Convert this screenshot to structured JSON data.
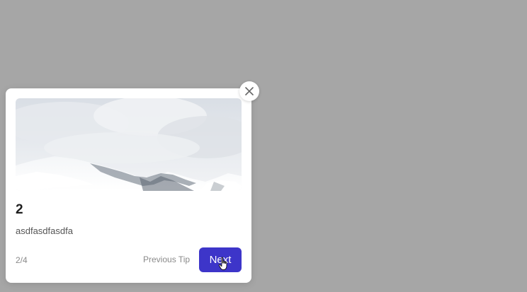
{
  "tip": {
    "title": "2",
    "body": "asdfasdfasdfa",
    "counter": "2/4",
    "previous_label": "Previous Tip",
    "next_label": "Next",
    "image_alt": "snowy-mountain-landscape"
  },
  "colors": {
    "overlay": "#a6a6a6",
    "card": "#ffffff",
    "accent": "#3d35c9",
    "muted_text": "#8a8a8a"
  },
  "icons": {
    "close": "close-icon",
    "cursor": "hand-pointer-icon"
  }
}
